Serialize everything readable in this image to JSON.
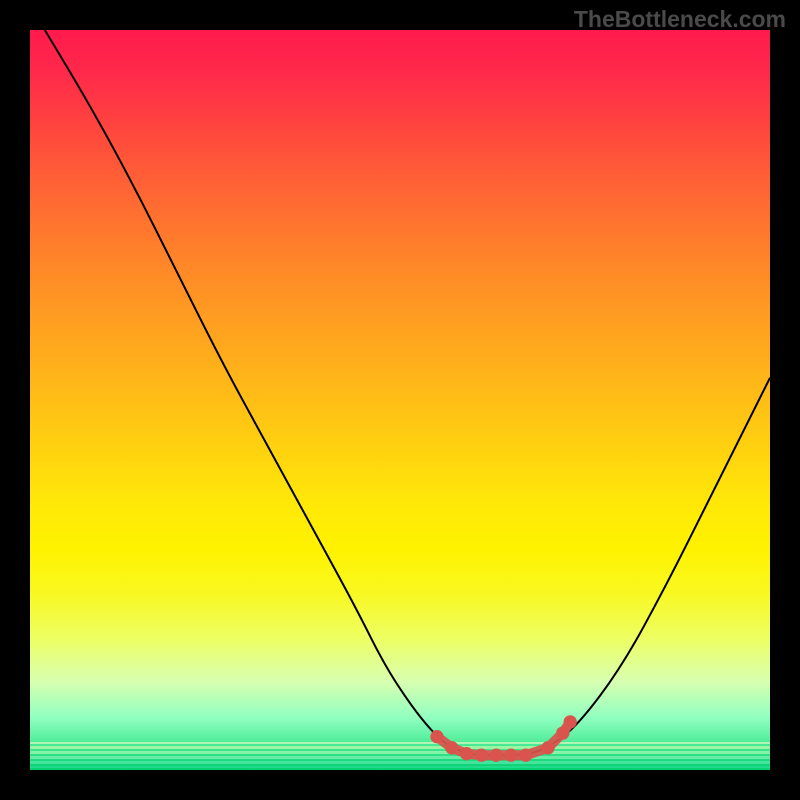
{
  "watermark": "TheBottleneck.com",
  "chart_data": {
    "type": "line",
    "title": "",
    "xlabel": "",
    "ylabel": "",
    "xlim": [
      0,
      100
    ],
    "ylim": [
      0,
      100
    ],
    "series": [
      {
        "name": "bottleneck-curve",
        "color": "#000000",
        "x": [
          2,
          8,
          14,
          20,
          26,
          32,
          38,
          44,
          48,
          52,
          55,
          57,
          60,
          62,
          67,
          70,
          74,
          80,
          86,
          92,
          98,
          100
        ],
        "y": [
          100,
          90,
          79,
          67,
          55,
          44,
          33,
          22,
          14,
          8,
          4.5,
          3,
          2,
          2,
          2,
          3,
          6,
          14,
          25,
          37,
          49,
          53
        ]
      },
      {
        "name": "optimal-range-dots",
        "color": "#d9544d",
        "type": "scatter",
        "x": [
          55,
          57,
          59,
          61,
          63,
          65,
          67,
          70,
          72,
          73
        ],
        "y": [
          4.5,
          3,
          2.2,
          2,
          2,
          2,
          2,
          3,
          5,
          6.5
        ]
      }
    ],
    "annotations": [],
    "background_gradient": {
      "stops": [
        {
          "pos": 0.0,
          "color": "#ff1a4d"
        },
        {
          "pos": 0.25,
          "color": "#ff7030"
        },
        {
          "pos": 0.5,
          "color": "#ffc010"
        },
        {
          "pos": 0.7,
          "color": "#fff200"
        },
        {
          "pos": 0.88,
          "color": "#d8ffb0"
        },
        {
          "pos": 1.0,
          "color": "#00d070"
        }
      ]
    }
  }
}
